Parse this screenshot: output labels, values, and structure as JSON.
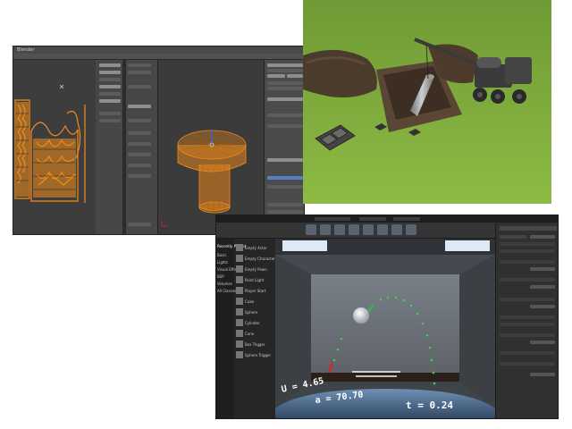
{
  "blender": {
    "title": "Blender",
    "colors": {
      "mesh": "#f28c1a",
      "background": "#3b3b3b"
    }
  },
  "game": {
    "colors": {
      "grass": "#7ea93a",
      "dirt": "#4a3a2a",
      "vehicle": "#3a3a3a"
    }
  },
  "ue_editor": {
    "left_panel": {
      "header": "Recently Placed",
      "categories": [
        "Basic",
        "Lights",
        "Visual Effects",
        "BSP",
        "Volumes",
        "All Classes"
      ],
      "items": [
        "Empty Actor",
        "Empty Character",
        "Empty Pawn",
        "Point Light",
        "Player Start",
        "Cube",
        "Sphere",
        "Cylinder",
        "Cone",
        "Box Trigger",
        "Sphere Trigger"
      ]
    },
    "viewport": {
      "u_text": "U = 4.65",
      "a_text": "a = 70.70",
      "t_text": "t = 0.24"
    },
    "colors": {
      "trajectory": "#3fcf4a",
      "arrow_red": "#d8262d",
      "arrow_green": "#39b54a"
    }
  }
}
